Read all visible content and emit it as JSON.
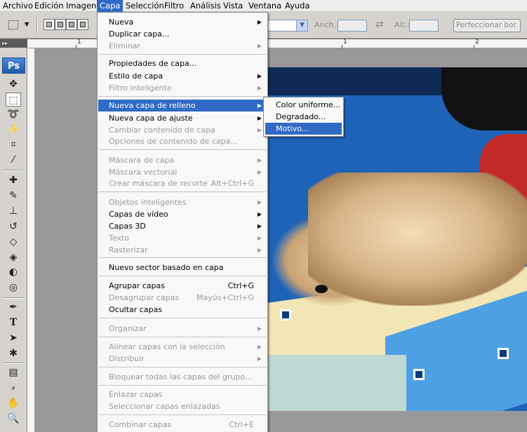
{
  "menubar": {
    "items": [
      "Archivo",
      "Edición",
      "Imagen",
      "Capa",
      "Selección",
      "Filtro",
      "Análisis",
      "Vista",
      "Ventana",
      "Ayuda"
    ],
    "active": "Capa"
  },
  "options_bar": {
    "width_label": "Anch.:",
    "height_label": "Alt.:",
    "refine_button": "Perfeccionar bor."
  },
  "toolbox": {
    "logo": "Ps"
  },
  "ruler": {
    "numbers": [
      "1",
      "1",
      "2"
    ]
  },
  "capa_menu": {
    "items": [
      {
        "label": "Nueva",
        "enabled": true,
        "submenu": true
      },
      {
        "label": "Duplicar capa...",
        "enabled": true
      },
      {
        "label": "Eliminar",
        "enabled": false,
        "submenu": true
      },
      {
        "label": "Propiedades de capa...",
        "enabled": true
      },
      {
        "label": "Estilo de capa",
        "enabled": true,
        "submenu": true
      },
      {
        "label": "Filtro inteligente",
        "enabled": false,
        "submenu": true
      },
      {
        "label": "Nueva capa de relleno",
        "enabled": true,
        "submenu": true,
        "highlighted": true
      },
      {
        "label": "Nueva capa de ajuste",
        "enabled": true,
        "submenu": true
      },
      {
        "label": "Cambiar contenido de capa",
        "enabled": false,
        "submenu": true
      },
      {
        "label": "Opciones de contenido de capa...",
        "enabled": false
      },
      {
        "label": "Máscara de capa",
        "enabled": false,
        "submenu": true
      },
      {
        "label": "Máscara vectorial",
        "enabled": false,
        "submenu": true
      },
      {
        "label": "Crear máscara de recorte",
        "enabled": false,
        "shortcut": "Alt+Ctrl+G"
      },
      {
        "label": "Objetos inteligentes",
        "enabled": false,
        "submenu": true
      },
      {
        "label": "Capas de vídeo",
        "enabled": true,
        "submenu": true
      },
      {
        "label": "Capas 3D",
        "enabled": true,
        "submenu": true
      },
      {
        "label": "Texto",
        "enabled": false,
        "submenu": true
      },
      {
        "label": "Rasterizar",
        "enabled": false,
        "submenu": true
      },
      {
        "label": "Nuevo sector basado en capa",
        "enabled": true
      },
      {
        "label": "Agrupar capas",
        "enabled": true,
        "shortcut": "Ctrl+G"
      },
      {
        "label": "Desagrupar capas",
        "enabled": false,
        "shortcut": "Mayús+Ctrl+G"
      },
      {
        "label": "Ocultar capas",
        "enabled": true
      },
      {
        "label": "Organizar",
        "enabled": false,
        "submenu": true
      },
      {
        "label": "Alinear capas con la selección",
        "enabled": false,
        "submenu": true
      },
      {
        "label": "Distribuir",
        "enabled": false,
        "submenu": true
      },
      {
        "label": "Bloquear todas las capas del grupo...",
        "enabled": false
      },
      {
        "label": "Enlazar capas",
        "enabled": false
      },
      {
        "label": "Seleccionar capas enlazadas",
        "enabled": false
      },
      {
        "label": "Combinar capas",
        "enabled": false,
        "shortcut": "Ctrl+E"
      }
    ]
  },
  "fill_submenu": {
    "items": [
      {
        "label": "Color uniforme...",
        "highlighted": false
      },
      {
        "label": "Degradado...",
        "highlighted": false
      },
      {
        "label": "Motivo...",
        "highlighted": true
      }
    ]
  }
}
